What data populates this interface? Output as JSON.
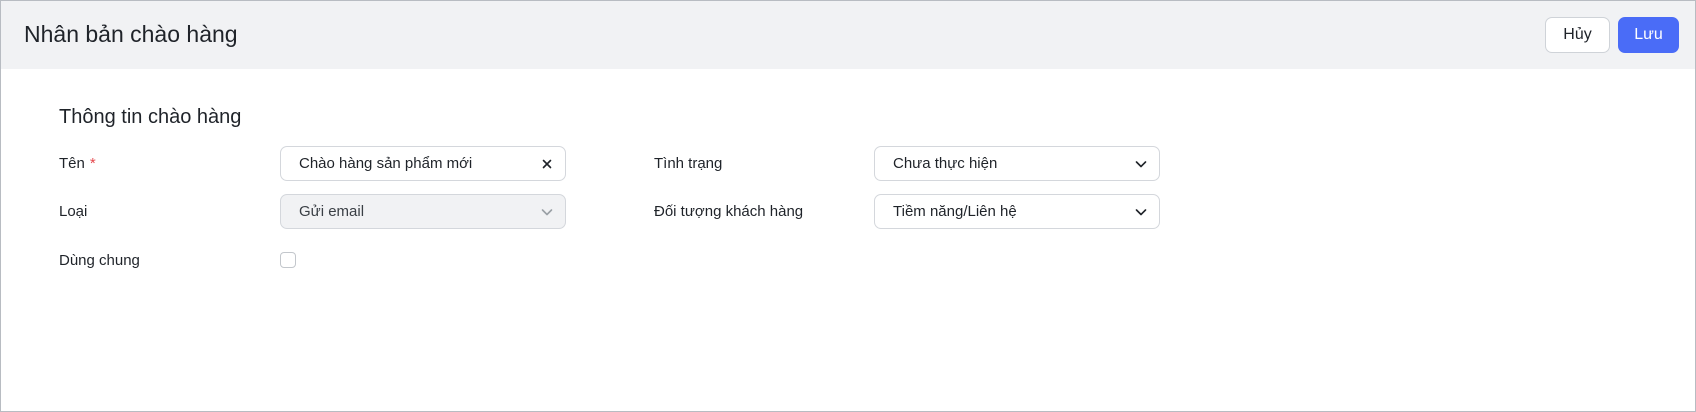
{
  "header": {
    "title": "Nhân bản chào hàng",
    "cancel_label": "Hủy",
    "save_label": "Lưu"
  },
  "section": {
    "title": "Thông tin chào hàng"
  },
  "form": {
    "name": {
      "label": "Tên",
      "required_mark": "*",
      "value": "Chào hàng sản phẩm mới",
      "clear_icon": "close-icon"
    },
    "type": {
      "label": "Loại",
      "value": "Gửi email",
      "disabled": true,
      "icon": "chevron-down-icon"
    },
    "shared": {
      "label": "Dùng chung",
      "checked": false
    },
    "status": {
      "label": "Tình trạng",
      "value": "Chưa thực hiện",
      "icon": "chevron-down-icon"
    },
    "customer_target": {
      "label": "Đối tượng khách hàng",
      "value": "Tiềm năng/Liên hệ",
      "icon": "chevron-down-icon"
    }
  },
  "colors": {
    "accent": "#4a6cf7",
    "required": "#e5484d",
    "header_bg": "#f1f2f4"
  }
}
